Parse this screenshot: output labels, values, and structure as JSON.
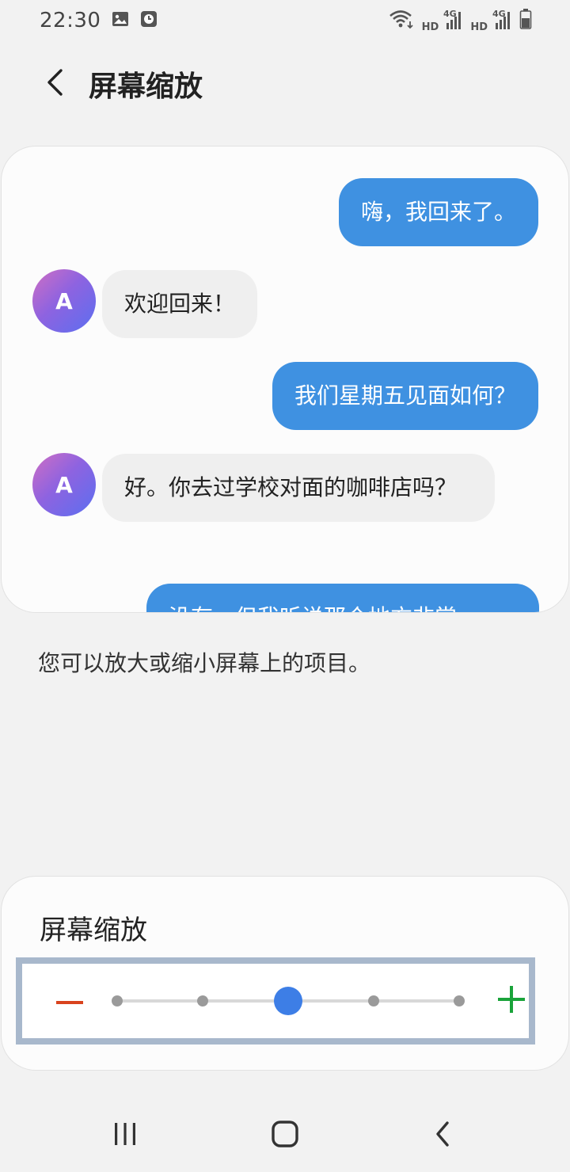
{
  "status_bar": {
    "time": "22:30",
    "left_icons": [
      "image-icon",
      "clock-icon"
    ],
    "right_icons": [
      "wifi-icon",
      "signal-icon",
      "signal-icon",
      "battery-icon"
    ],
    "network_1": "HD",
    "network_1_type": "4G",
    "network_2": "HD",
    "network_2_type": "4G"
  },
  "header": {
    "title": "屏幕缩放",
    "back_icon": "chevron-left-icon"
  },
  "preview": {
    "messages": [
      {
        "type": "out",
        "text": "嗨，我回来了。"
      },
      {
        "type": "in",
        "avatar": "A",
        "text": "欢迎回来！"
      },
      {
        "type": "out",
        "text": "我们星期五见面如何？"
      },
      {
        "type": "in",
        "avatar": "A",
        "text": "好。你去过学校对面的咖啡店吗？"
      },
      {
        "type": "out",
        "text": "没有，但我听说那个地方非常"
      }
    ]
  },
  "description": "您可以放大或缩小屏幕上的项目。",
  "zoom": {
    "title": "屏幕缩放",
    "minus_icon": "minus-icon",
    "plus_icon": "plus-icon",
    "minus_color": "#d9431e",
    "plus_color": "#1aa33a",
    "steps": 5,
    "current_step": 3,
    "thumb_color": "#3d7ee6"
  },
  "nav_bar": {
    "icons": [
      "recent-apps-icon",
      "home-icon",
      "back-icon"
    ]
  },
  "colors": {
    "accent": "#3f91e1",
    "background": "#f2f2f2"
  }
}
